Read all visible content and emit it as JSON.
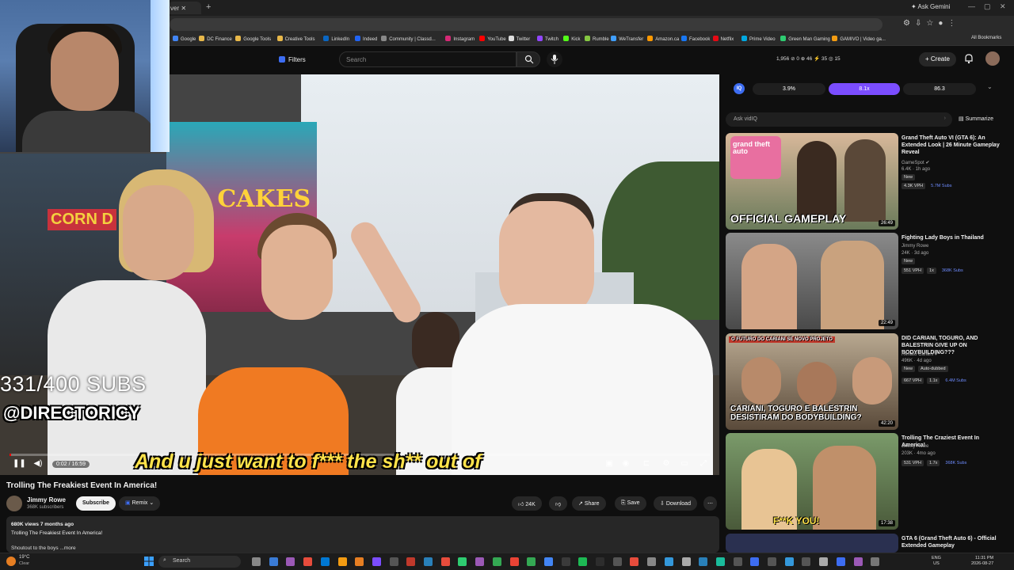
{
  "browser": {
    "tab_title": "ver",
    "gemini_label": "Ask Gemini",
    "bookmarks": [
      {
        "label": "Google",
        "color": "#4285f4"
      },
      {
        "label": "DC Finance",
        "color": "#e8b84a"
      },
      {
        "label": "Google Tools",
        "color": "#e8b84a"
      },
      {
        "label": "Creative Tools",
        "color": "#e8b84a"
      },
      {
        "label": "LinkedIn",
        "color": "#0a66c2"
      },
      {
        "label": "Indeed",
        "color": "#2164f3"
      },
      {
        "label": "Community | Classd...",
        "color": "#888888"
      },
      {
        "label": "Instagram",
        "color": "#d62976"
      },
      {
        "label": "YouTube",
        "color": "#ff0000"
      },
      {
        "label": "Twitter",
        "color": "#dddddd"
      },
      {
        "label": "Twitch",
        "color": "#9146ff"
      },
      {
        "label": "Kick",
        "color": "#53fc18"
      },
      {
        "label": "Rumble",
        "color": "#85c742"
      },
      {
        "label": "WeTransfer",
        "color": "#409fff"
      },
      {
        "label": "Amazon.ca",
        "color": "#ff9900"
      },
      {
        "label": "Facebook",
        "color": "#1877f2"
      },
      {
        "label": "Netflix",
        "color": "#e50914"
      },
      {
        "label": "Prime Video",
        "color": "#00a8e1"
      },
      {
        "label": "Green Man Gaming",
        "color": "#2ecc71"
      },
      {
        "label": "GAMIVO | Video ga...",
        "color": "#f39c12"
      }
    ],
    "all_bookmarks": "All Bookmarks"
  },
  "youtube_header": {
    "filters_label": "Filters",
    "search_placeholder": "Search",
    "stats": "1,956  ⊘ 0  ⊕ 46  ⚡ 35  ◎ 15",
    "create_label": "Create"
  },
  "overlay": {
    "subs_text": "331/400 SUBS",
    "handle_text": "@DIRECTORICY",
    "caption": "And u just want to f*** the sh** out of",
    "booth_sign": "EL CAKES",
    "corn_sign": "CORN D"
  },
  "player": {
    "time": "0:02 / 16:59",
    "progress": 0.002
  },
  "video": {
    "title": "Trolling The Freakiest Event In America!",
    "channel": "Jimmy Rowe",
    "channel_subs": "368K subscribers",
    "subscribe_label": "Subscribe",
    "remix_label": "Remix",
    "likes": "24K",
    "share_label": "Share",
    "save_label": "Save",
    "download_label": "Download",
    "views_date": "680K views  7 months ago",
    "desc_title": "Trolling The Freakiest Event In America!",
    "desc_more": "Shoutout to the boys  ...more"
  },
  "vidiq": {
    "seg1": "3.9%",
    "seg2": "8.1x",
    "seg3": "86.3",
    "ask_placeholder": "Ask vidIQ",
    "summarize_label": "Summarize"
  },
  "sidebar": {
    "videos": [
      {
        "title": "Grand Theft Auto VI (GTA 6): An Extended Look | 26 Minute Gameplay Reveal",
        "channel": "GameSpot",
        "views": "6.4K · 1h ago",
        "new_badge": "New",
        "vph": "4.3K VPH",
        "subs": "5.7M Subs",
        "duration": "26:49",
        "thumb_caption": "OFFICIAL GAMEPLAY",
        "thumb_logo": "grand theft auto"
      },
      {
        "title": "Fighting Lady Boys in Thailand",
        "channel": "Jimmy Rowe",
        "views": "24K · 3d ago",
        "new_badge": "New",
        "vph": "551 VPH",
        "mult": "1x",
        "subs": "368K Subs",
        "duration": "22:49"
      },
      {
        "title": "DID CARIANI, TOGURO, AND BALESTRIN GIVE UP ON BODYBUILDING???",
        "channel": "Renato Cariani",
        "views": "496K · 4d ago",
        "new_badge": "New",
        "extra_badge": "Auto-dubbed",
        "vph": "667 VPH",
        "mult": "1.1x",
        "subs": "6.4M Subs",
        "duration": "42:20",
        "thumb_caption": "CARIANI, TOGURO E BALESTRIN DESISTIRAM DO BODYBUILDING?",
        "thumb_top": "O FUTURO DO CARIANI SE NOVO PROJETO"
      },
      {
        "title": "Trolling The Craziest Event In America!",
        "channel": "Jimmy Rowe",
        "views": "203K · 4mo ago",
        "vph": "531 VPH",
        "mult": "1.7x",
        "subs": "368K Subs",
        "duration": "17:38",
        "thumb_caption": "F**K YOU!"
      },
      {
        "title": "GTA 6 (Grand Theft Auto 6) - Official Extended Gameplay",
        "channel": "",
        "views": "",
        "duration": ""
      }
    ]
  },
  "taskbar": {
    "temp": "19°C",
    "weather": "Clear",
    "search_label": "Search",
    "lang1": "ENG",
    "lang2": "US",
    "time": "11:31 PM",
    "date": "2026-08-27"
  },
  "colors": {
    "yt_bg": "#0f0f0f",
    "accent_red": "#ff0000",
    "vidiq_purple": "#7b4dff",
    "caption_yellow": "#ffe34a"
  }
}
